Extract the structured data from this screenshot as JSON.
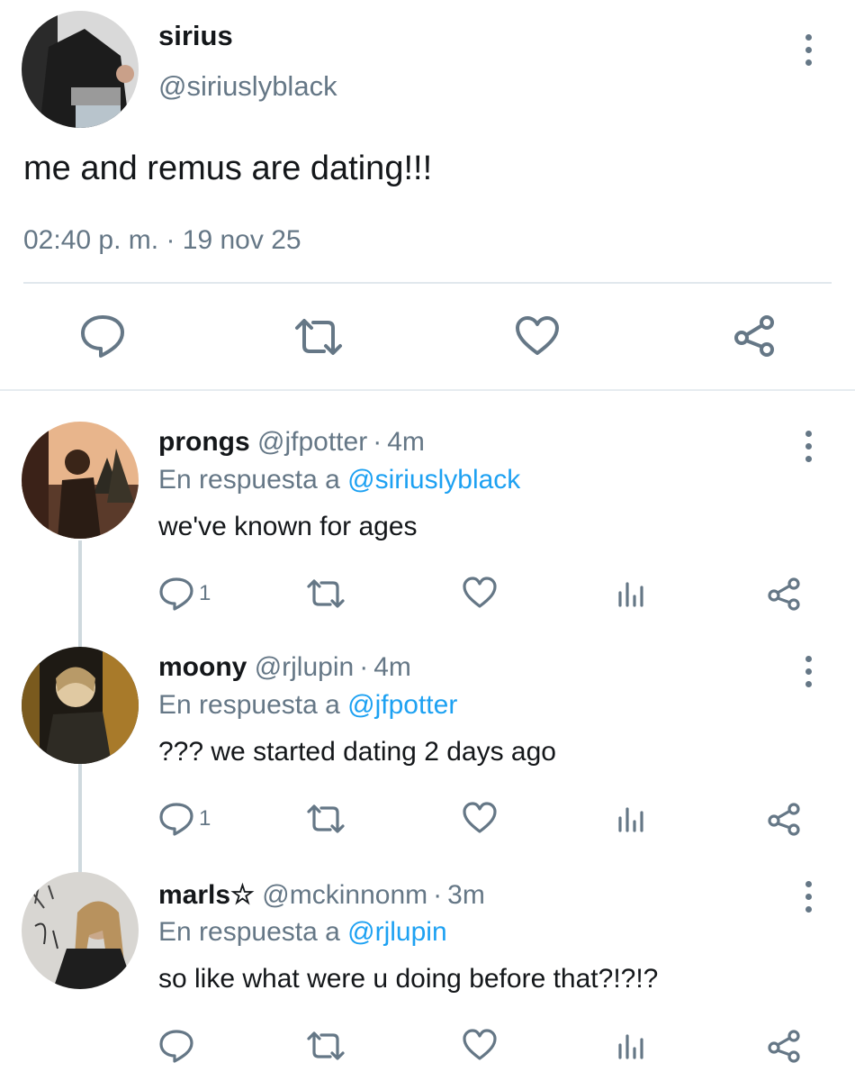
{
  "main_tweet": {
    "display_name": "sirius",
    "handle": "@siriuslyblack",
    "text": "me and remus are dating!!!",
    "time": "02:40 p. m.",
    "separator": "·",
    "date": "19 nov 25"
  },
  "replies": [
    {
      "display_name": "prongs",
      "handle": "@jfpotter",
      "separator": "·",
      "age": "4m",
      "reply_prefix": "En respuesta a",
      "reply_to": "@siriuslyblack",
      "text": "we've known for ages",
      "reply_count": "1"
    },
    {
      "display_name": "moony",
      "handle": "@rjlupin",
      "separator": "·",
      "age": "4m",
      "reply_prefix": "En respuesta a",
      "reply_to": "@jfpotter",
      "text": "??? we started dating 2 days ago",
      "reply_count": "1"
    },
    {
      "display_name": "marls☆",
      "handle": "@mckinnonm",
      "separator": "·",
      "age": "3m",
      "reply_prefix": "En respuesta a",
      "reply_to": "@rjlupin",
      "text": "so like what were u doing before that?!?!?",
      "reply_count": ""
    }
  ],
  "colors": {
    "text": "#14171a",
    "muted": "#657786",
    "link": "#1da1f2",
    "divider": "#e1e8ed",
    "thread_line": "#cfd9de"
  },
  "icons": [
    "reply-icon",
    "retweet-icon",
    "like-icon",
    "analytics-icon",
    "share-icon",
    "more-options-icon"
  ]
}
